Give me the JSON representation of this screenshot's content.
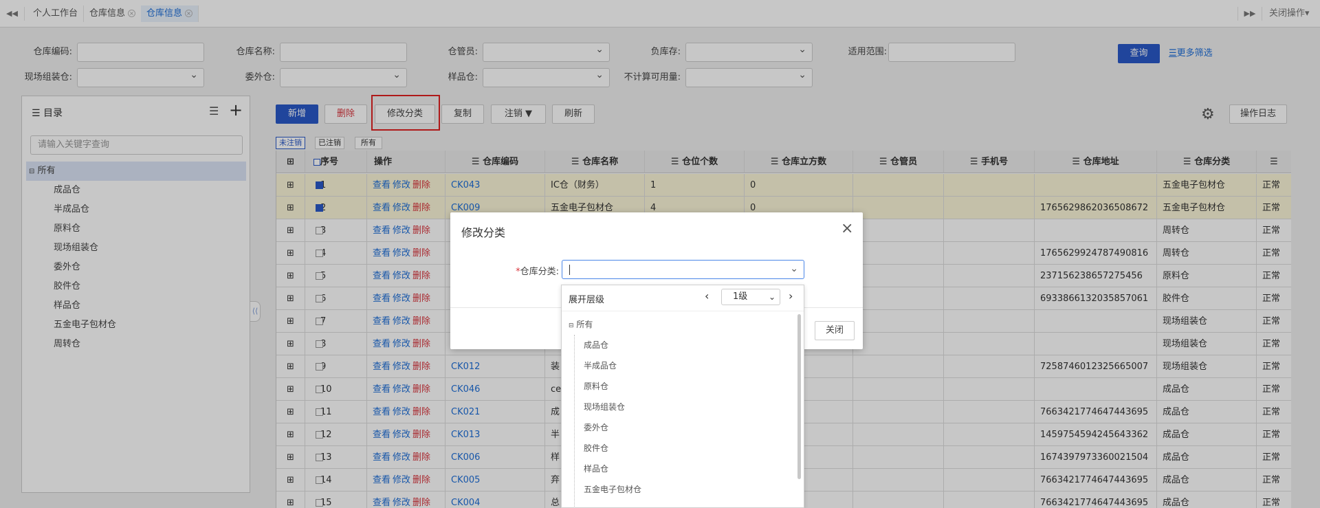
{
  "tabs": {
    "items": [
      {
        "label": "个人工作台"
      },
      {
        "label": "仓库信息"
      },
      {
        "label": "仓库信息"
      }
    ],
    "close_ops": "关闭操作"
  },
  "filters": {
    "code": "仓库编码:",
    "name": "仓库名称:",
    "keeper": "仓管员:",
    "negative": "负库存:",
    "scope": "适用范围:",
    "assembly": "现场组装仓:",
    "outsource": "委外仓:",
    "sample": "样品仓:",
    "no_calc": "不计算可用量:",
    "query": "查询",
    "more": "更多筛选"
  },
  "tree": {
    "title": "目录",
    "search_placeholder": "请输入关键字查询",
    "root": "所有",
    "items": [
      "成品仓",
      "半成品仓",
      "原料仓",
      "现场组装仓",
      "委外仓",
      "胶件仓",
      "样品仓",
      "五金电子包材仓",
      "周转仓"
    ]
  },
  "toolbar": {
    "add": "新增",
    "delete": "删除",
    "modify_category": "修改分类",
    "copy": "复制",
    "cancel": "注销 ▼",
    "refresh": "刷新",
    "log": "操作日志"
  },
  "status_tabs": [
    "未注销",
    "已注销",
    "所有"
  ],
  "columns": [
    "序号",
    "操作",
    "仓库编码",
    "仓库名称",
    "仓位个数",
    "仓库立方数",
    "仓管员",
    "手机号",
    "仓库地址",
    "仓库分类"
  ],
  "row_actions": {
    "view": "查看",
    "edit": "修改",
    "delete": "删除"
  },
  "rows": [
    {
      "no": "1",
      "code": "CK043",
      "name": "IC仓（财务）",
      "slots": "1",
      "volume": "0",
      "addr": "",
      "cat": "五金电子包材仓",
      "status": "正常",
      "checked": true
    },
    {
      "no": "2",
      "code": "CK009",
      "name": "五金电子包材仓",
      "slots": "4",
      "volume": "0",
      "addr": "1765629862036508672",
      "cat": "五金电子包材仓",
      "status": "正常",
      "checked": true
    },
    {
      "no": "3",
      "code": "",
      "name": "",
      "slots": "",
      "volume": "",
      "addr": "",
      "cat": "周转仓",
      "status": "正常",
      "checked": false
    },
    {
      "no": "4",
      "code": "",
      "name": "",
      "slots": "",
      "volume": "",
      "addr": "1765629924787490816",
      "cat": "周转仓",
      "status": "正常",
      "checked": false
    },
    {
      "no": "5",
      "code": "",
      "name": "",
      "slots": "",
      "volume": "",
      "addr": "237156238657275456",
      "cat": "原料仓",
      "status": "正常",
      "checked": false
    },
    {
      "no": "6",
      "code": "",
      "name": "",
      "slots": "",
      "volume": "",
      "addr": "6933866132035857061",
      "cat": "胶件仓",
      "status": "正常",
      "checked": false
    },
    {
      "no": "7",
      "code": "",
      "name": "",
      "slots": "",
      "volume": "",
      "addr": "",
      "cat": "现场组装仓",
      "status": "正常",
      "checked": false
    },
    {
      "no": "8",
      "code": "",
      "name": "",
      "slots": "",
      "volume": "",
      "addr": "",
      "cat": "现场组装仓",
      "status": "正常",
      "checked": false
    },
    {
      "no": "9",
      "code": "CK012",
      "name": "装",
      "slots": "",
      "volume": "",
      "addr": "7258746012325665007",
      "cat": "现场组装仓",
      "status": "正常",
      "checked": false
    },
    {
      "no": "10",
      "code": "CK046",
      "name": "ce",
      "slots": "",
      "volume": "",
      "addr": "",
      "cat": "成品仓",
      "status": "正常",
      "checked": false
    },
    {
      "no": "11",
      "code": "CK021",
      "name": "成",
      "slots": "",
      "volume": "",
      "addr": "7663421774647443695",
      "cat": "成品仓",
      "status": "正常",
      "checked": false
    },
    {
      "no": "12",
      "code": "CK013",
      "name": "半",
      "slots": "",
      "volume": "",
      "addr": "1459754594245643362",
      "cat": "成品仓",
      "status": "正常",
      "checked": false
    },
    {
      "no": "13",
      "code": "CK006",
      "name": "样",
      "slots": "",
      "volume": "",
      "addr": "1674397973360021504",
      "cat": "成品仓",
      "status": "正常",
      "checked": false
    },
    {
      "no": "14",
      "code": "CK005",
      "name": "弃",
      "slots": "",
      "volume": "",
      "addr": "7663421774647443695",
      "cat": "成品仓",
      "status": "正常",
      "checked": false
    },
    {
      "no": "15",
      "code": "CK004",
      "name": "总",
      "slots": "",
      "volume": "",
      "addr": "7663421774647443695",
      "cat": "成品仓",
      "status": "正常",
      "checked": false
    }
  ],
  "modal": {
    "title": "修改分类",
    "required_mark": "*",
    "field_label": "仓库分类:",
    "close_button": "关闭"
  },
  "dropdown": {
    "expand_label": "展开层级",
    "level": "1级",
    "root": "所有",
    "items": [
      "成品仓",
      "半成品仓",
      "原料仓",
      "现场组装仓",
      "委外仓",
      "胶件仓",
      "样品仓",
      "五金电子包材仓"
    ]
  },
  "colors": {
    "primary": "#2a59c8",
    "link": "#1e6fd9",
    "danger": "#d9363e",
    "highlight_box": "#e02020"
  }
}
